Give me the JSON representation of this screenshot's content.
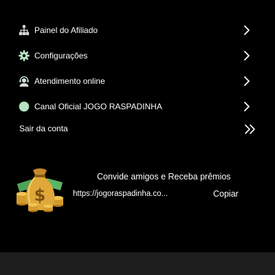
{
  "menu": {
    "items": [
      {
        "label": "Painel do Afiliado",
        "icon": "affiliate-network-icon"
      },
      {
        "label": "Configurações",
        "icon": "gear-icon"
      },
      {
        "label": "Atendimento online",
        "icon": "support-agent-icon"
      },
      {
        "label": "Canal Oficial JOGO RASPADINHA",
        "icon": "channel-icon"
      }
    ]
  },
  "logout": {
    "label": "Sair da conta",
    "icon": "double-chevron-right-icon"
  },
  "invite": {
    "title": "Convide amigos e Receba prêmios",
    "link": "https://jogoraspadinha.co...",
    "copy_label": "Copiar",
    "image": "money-bag-icon"
  },
  "colors": {
    "background": "#000000",
    "text": "#ffffff",
    "icon_primary": "#d9d9d9",
    "icon_accent": "#b9e3c6",
    "bottom_bar": "#1e1e1e",
    "gold": "#e0a83a"
  }
}
